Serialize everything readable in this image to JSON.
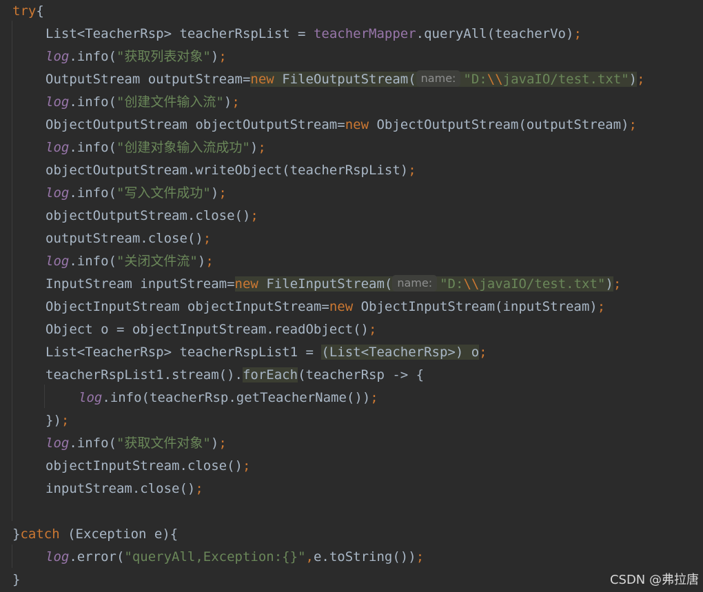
{
  "watermark": "CSDN @弗拉唐",
  "code_lines": [
    {
      "indent": 0,
      "tokens": [
        {
          "t": "kw",
          "v": "try"
        },
        {
          "t": "p",
          "v": "{"
        }
      ]
    },
    {
      "indent": 1,
      "tokens": [
        {
          "t": "p",
          "v": "List<TeacherRsp> teacherRspList = "
        },
        {
          "t": "fld",
          "v": "teacherMapper"
        },
        {
          "t": "p",
          "v": ".queryAll(teacherVo)"
        },
        {
          "t": "kw",
          "v": ";"
        }
      ]
    },
    {
      "indent": 1,
      "tokens": [
        {
          "t": "log",
          "v": "log"
        },
        {
          "t": "p",
          "v": ".info("
        },
        {
          "t": "str",
          "v": "\"获取列表对象\""
        },
        {
          "t": "p",
          "v": ")"
        },
        {
          "t": "kw",
          "v": ";"
        }
      ]
    },
    {
      "indent": 1,
      "tokens": [
        {
          "t": "p",
          "v": "OutputStream outputStream="
        },
        {
          "t": "hl-start"
        },
        {
          "t": "kw",
          "v": "new"
        },
        {
          "t": "p",
          "v": " FileOutputStream("
        },
        {
          "t": "hint",
          "v": "name:"
        },
        {
          "t": "str",
          "v": "\"D:"
        },
        {
          "t": "esc",
          "v": "\\\\"
        },
        {
          "t": "str",
          "v": "javaIO/test.txt\""
        },
        {
          "t": "p",
          "v": ")"
        },
        {
          "t": "hl-end"
        },
        {
          "t": "kw",
          "v": ";"
        }
      ]
    },
    {
      "indent": 1,
      "tokens": [
        {
          "t": "log",
          "v": "log"
        },
        {
          "t": "p",
          "v": ".info("
        },
        {
          "t": "str",
          "v": "\"创建文件输入流\""
        },
        {
          "t": "p",
          "v": ")"
        },
        {
          "t": "kw",
          "v": ";"
        }
      ]
    },
    {
      "indent": 1,
      "tokens": [
        {
          "t": "p",
          "v": "ObjectOutputStream objectOutputStream="
        },
        {
          "t": "kw",
          "v": "new"
        },
        {
          "t": "p",
          "v": " ObjectOutputStream(outputStream)"
        },
        {
          "t": "kw",
          "v": ";"
        }
      ]
    },
    {
      "indent": 1,
      "tokens": [
        {
          "t": "log",
          "v": "log"
        },
        {
          "t": "p",
          "v": ".info("
        },
        {
          "t": "str",
          "v": "\"创建对象输入流成功\""
        },
        {
          "t": "p",
          "v": ")"
        },
        {
          "t": "kw",
          "v": ";"
        }
      ]
    },
    {
      "indent": 1,
      "tokens": [
        {
          "t": "p",
          "v": "objectOutputStream.writeObject(teacherRspList)"
        },
        {
          "t": "kw",
          "v": ";"
        }
      ]
    },
    {
      "indent": 1,
      "tokens": [
        {
          "t": "log",
          "v": "log"
        },
        {
          "t": "p",
          "v": ".info("
        },
        {
          "t": "str",
          "v": "\"写入文件成功\""
        },
        {
          "t": "p",
          "v": ")"
        },
        {
          "t": "kw",
          "v": ";"
        }
      ]
    },
    {
      "indent": 1,
      "tokens": [
        {
          "t": "p",
          "v": "objectOutputStream.close()"
        },
        {
          "t": "kw",
          "v": ";"
        }
      ]
    },
    {
      "indent": 1,
      "tokens": [
        {
          "t": "p",
          "v": "outputStream.close()"
        },
        {
          "t": "kw",
          "v": ";"
        }
      ]
    },
    {
      "indent": 1,
      "tokens": [
        {
          "t": "log",
          "v": "log"
        },
        {
          "t": "p",
          "v": ".info("
        },
        {
          "t": "str",
          "v": "\"关闭文件流\""
        },
        {
          "t": "p",
          "v": ")"
        },
        {
          "t": "kw",
          "v": ";"
        }
      ]
    },
    {
      "indent": 1,
      "tokens": [
        {
          "t": "p",
          "v": "InputStream inputStream="
        },
        {
          "t": "hl-start"
        },
        {
          "t": "kw",
          "v": "new"
        },
        {
          "t": "p",
          "v": " FileInputStream("
        },
        {
          "t": "hint",
          "v": "name:"
        },
        {
          "t": "str",
          "v": "\"D:"
        },
        {
          "t": "esc",
          "v": "\\\\"
        },
        {
          "t": "str",
          "v": "javaIO/test.txt\""
        },
        {
          "t": "p",
          "v": ")"
        },
        {
          "t": "hl-end"
        },
        {
          "t": "kw",
          "v": ";"
        }
      ]
    },
    {
      "indent": 1,
      "tokens": [
        {
          "t": "p",
          "v": "ObjectInputStream objectInputStream="
        },
        {
          "t": "kw",
          "v": "new"
        },
        {
          "t": "p",
          "v": " ObjectInputStream(inputStream)"
        },
        {
          "t": "kw",
          "v": ";"
        }
      ]
    },
    {
      "indent": 1,
      "tokens": [
        {
          "t": "p",
          "v": "Object o = objectInputStream.readObject()"
        },
        {
          "t": "kw",
          "v": ";"
        }
      ]
    },
    {
      "indent": 1,
      "tokens": [
        {
          "t": "p",
          "v": "List<TeacherRsp> teacherRspList1 = "
        },
        {
          "t": "hl-start"
        },
        {
          "t": "p",
          "v": "(List<TeacherRsp>) o"
        },
        {
          "t": "hl-end"
        },
        {
          "t": "kw",
          "v": ";"
        }
      ]
    },
    {
      "indent": 1,
      "tokens": [
        {
          "t": "p",
          "v": "teacherRspList1.stream()."
        },
        {
          "t": "hl-start"
        },
        {
          "t": "p",
          "v": "forEach"
        },
        {
          "t": "hl-end"
        },
        {
          "t": "p",
          "v": "(teacherRsp -> {"
        }
      ]
    },
    {
      "indent": 2,
      "tokens": [
        {
          "t": "log",
          "v": "log"
        },
        {
          "t": "p",
          "v": ".info(teacherRsp.getTeacherName())"
        },
        {
          "t": "kw",
          "v": ";"
        }
      ]
    },
    {
      "indent": 1,
      "tokens": [
        {
          "t": "p",
          "v": "})"
        },
        {
          "t": "kw",
          "v": ";"
        }
      ]
    },
    {
      "indent": 1,
      "tokens": [
        {
          "t": "log",
          "v": "log"
        },
        {
          "t": "p",
          "v": ".info("
        },
        {
          "t": "str",
          "v": "\"获取文件对象\""
        },
        {
          "t": "p",
          "v": ")"
        },
        {
          "t": "kw",
          "v": ";"
        }
      ]
    },
    {
      "indent": 1,
      "tokens": [
        {
          "t": "p",
          "v": "objectInputStream.close()"
        },
        {
          "t": "kw",
          "v": ";"
        }
      ]
    },
    {
      "indent": 1,
      "tokens": [
        {
          "t": "p",
          "v": "inputStream.close()"
        },
        {
          "t": "kw",
          "v": ";"
        }
      ]
    },
    {
      "indent": 0,
      "tokens": []
    },
    {
      "indent": 0,
      "tokens": [
        {
          "t": "p",
          "v": "}"
        },
        {
          "t": "kw",
          "v": "catch"
        },
        {
          "t": "p",
          "v": " (Exception e){"
        }
      ]
    },
    {
      "indent": 1,
      "tokens": [
        {
          "t": "log",
          "v": "log"
        },
        {
          "t": "p",
          "v": ".error("
        },
        {
          "t": "str",
          "v": "\"queryAll,Exception:{}\""
        },
        {
          "t": "kw",
          "v": ","
        },
        {
          "t": "p",
          "v": "e.toString())"
        },
        {
          "t": "kw",
          "v": ";"
        }
      ]
    },
    {
      "indent": 0,
      "tokens": [
        {
          "t": "p",
          "v": "}"
        }
      ]
    }
  ]
}
